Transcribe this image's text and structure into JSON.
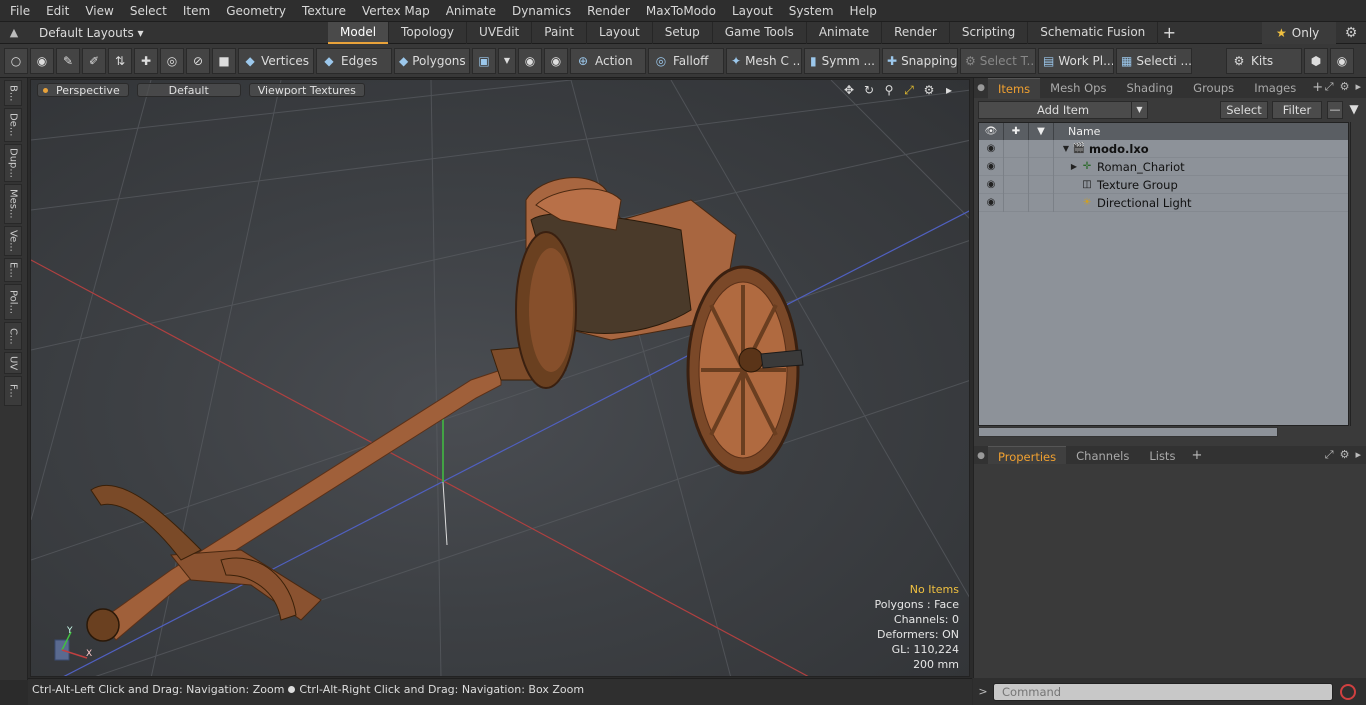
{
  "menu": [
    "File",
    "Edit",
    "View",
    "Select",
    "Item",
    "Geometry",
    "Texture",
    "Vertex Map",
    "Animate",
    "Dynamics",
    "Render",
    "MaxToModo",
    "Layout",
    "System",
    "Help"
  ],
  "layout_selector": "Default Layouts ▾",
  "layout_tabs": [
    "Model",
    "Topology",
    "UVEdit",
    "Paint",
    "Layout",
    "Setup",
    "Game Tools",
    "Animate",
    "Render",
    "Scripting",
    "Schematic Fusion"
  ],
  "active_layout_tab": "Model",
  "only_label": "Only",
  "toolbar": {
    "vertices": "Vertices",
    "edges": "Edges",
    "polygons": "Polygons",
    "action": "Action",
    "falloff": "Falloff",
    "mesh": "Mesh C ...",
    "symm": "Symm ...",
    "snapping": "Snapping",
    "select_t": "Select T...",
    "work_pl": "Work Pl...",
    "selecti": "Selecti ...",
    "kits": "Kits"
  },
  "left_tabs": [
    "B...",
    "De...",
    "Dup...",
    "Mes...",
    "Ve...",
    "E...",
    "Pol...",
    "C...",
    "UV",
    "F..."
  ],
  "viewport": {
    "view_mode": "Perspective",
    "shading": "Default",
    "textures": "Viewport Textures",
    "info": {
      "no_items": "No Items",
      "polygons": "Polygons : Face",
      "channels": "Channels: 0",
      "deformers": "Deformers: ON",
      "gl": "GL: 110,224",
      "scale": "200 mm"
    }
  },
  "status": {
    "left": "Ctrl-Alt-Left Click and Drag: Navigation: Zoom",
    "right": "Ctrl-Alt-Right Click and Drag: Navigation: Box Zoom"
  },
  "items_panel": {
    "tabs": [
      "Items",
      "Mesh Ops",
      "Shading",
      "Groups",
      "Images"
    ],
    "active_tab": "Items",
    "add_item": "Add Item",
    "select": "Select",
    "filter": "Filter",
    "column_name": "Name",
    "rows": [
      {
        "label": "modo.lxo",
        "icon": "scene-icon"
      },
      {
        "label": "Roman_Chariot",
        "icon": "mesh-locator-icon"
      },
      {
        "label": "Texture Group",
        "icon": "texture-group-icon"
      },
      {
        "label": "Directional Light",
        "icon": "light-icon"
      }
    ]
  },
  "properties_panel": {
    "tabs": [
      "Properties",
      "Channels",
      "Lists"
    ],
    "active_tab": "Properties"
  },
  "command_placeholder": "Command"
}
